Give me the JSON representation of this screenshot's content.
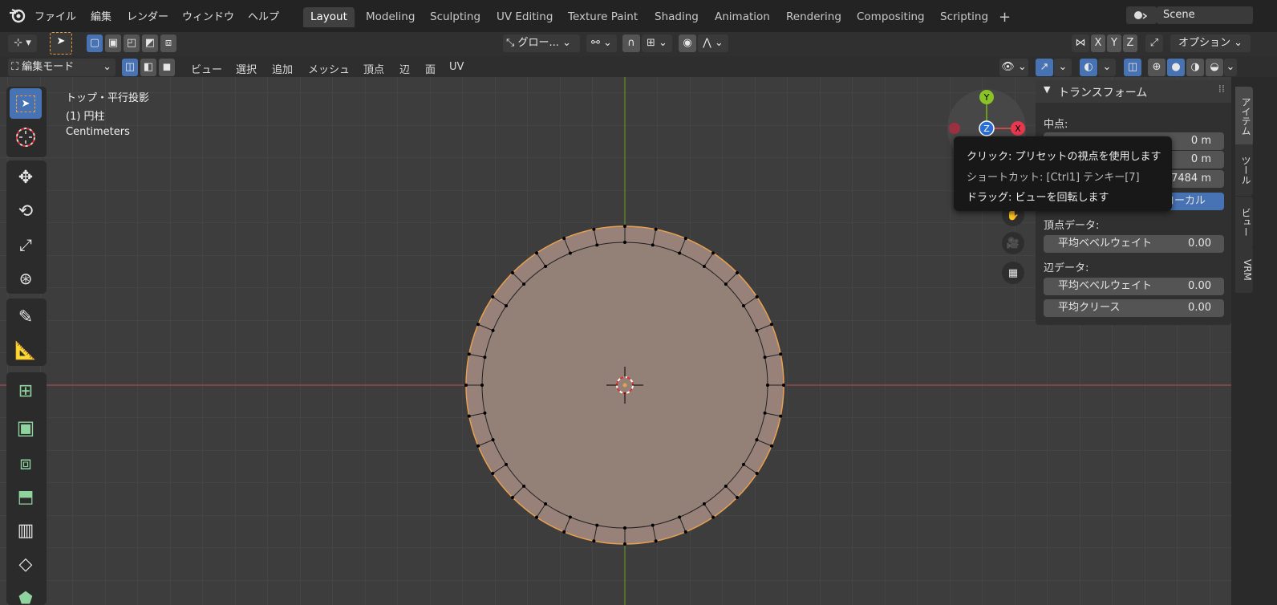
{
  "menu": {
    "file": "ファイル",
    "edit": "編集",
    "render": "レンダー",
    "window": "ウィンドウ",
    "help": "ヘルプ"
  },
  "workspaces": [
    "Layout",
    "Modeling",
    "Sculpting",
    "UV Editing",
    "Texture Paint",
    "Shading",
    "Animation",
    "Rendering",
    "Compositing",
    "Scripting"
  ],
  "workspace_add": "+",
  "scene": {
    "name": "Scene"
  },
  "tool_header": {
    "transform_orientation": "グロー...",
    "axis_x": "X",
    "axis_y": "Y",
    "axis_z": "Z",
    "options": "オプション"
  },
  "editor_header": {
    "mode": "編集モード",
    "view": "ビュー",
    "select": "選択",
    "add": "追加",
    "mesh": "メッシュ",
    "vertex": "頂点",
    "edge": "辺",
    "face": "面",
    "uv": "UV"
  },
  "viewport_info": {
    "view_name": "トップ・平行投影",
    "object": "(1) 円柱",
    "units": "Centimeters"
  },
  "gizmo": {
    "x": "X",
    "y": "Y",
    "z": "Z"
  },
  "npanel": {
    "header": "トランスフォーム",
    "median_label": "中点:",
    "x_value": "0 m",
    "y_value": "0 m",
    "z_value": "0.047484 m",
    "local_toggle": "ローカル",
    "vertex_data_label": "頂点データ:",
    "vertex_bevel_label": "平均ベベルウェイト",
    "vertex_bevel_value": "0.00",
    "edge_data_label": "辺データ:",
    "edge_bevel_label": "平均ベベルウェイト",
    "edge_bevel_value": "0.00",
    "edge_crease_label": "平均クリース",
    "edge_crease_value": "0.00"
  },
  "side_tabs": [
    "アイテム",
    "ツール",
    "ビュー",
    "VRM"
  ],
  "tooltip": {
    "line1": "クリック: プリセットの視点を使用します",
    "line2": "ショートカット: [Ctrl1] テンキー[7]",
    "line3": "ドラッグ: ビューを回転します"
  },
  "colors": {
    "accent": "#4772b3",
    "mesh_fill": "#978178",
    "x_axis": "#c44b4b",
    "y_axis": "#6a9a1e"
  }
}
